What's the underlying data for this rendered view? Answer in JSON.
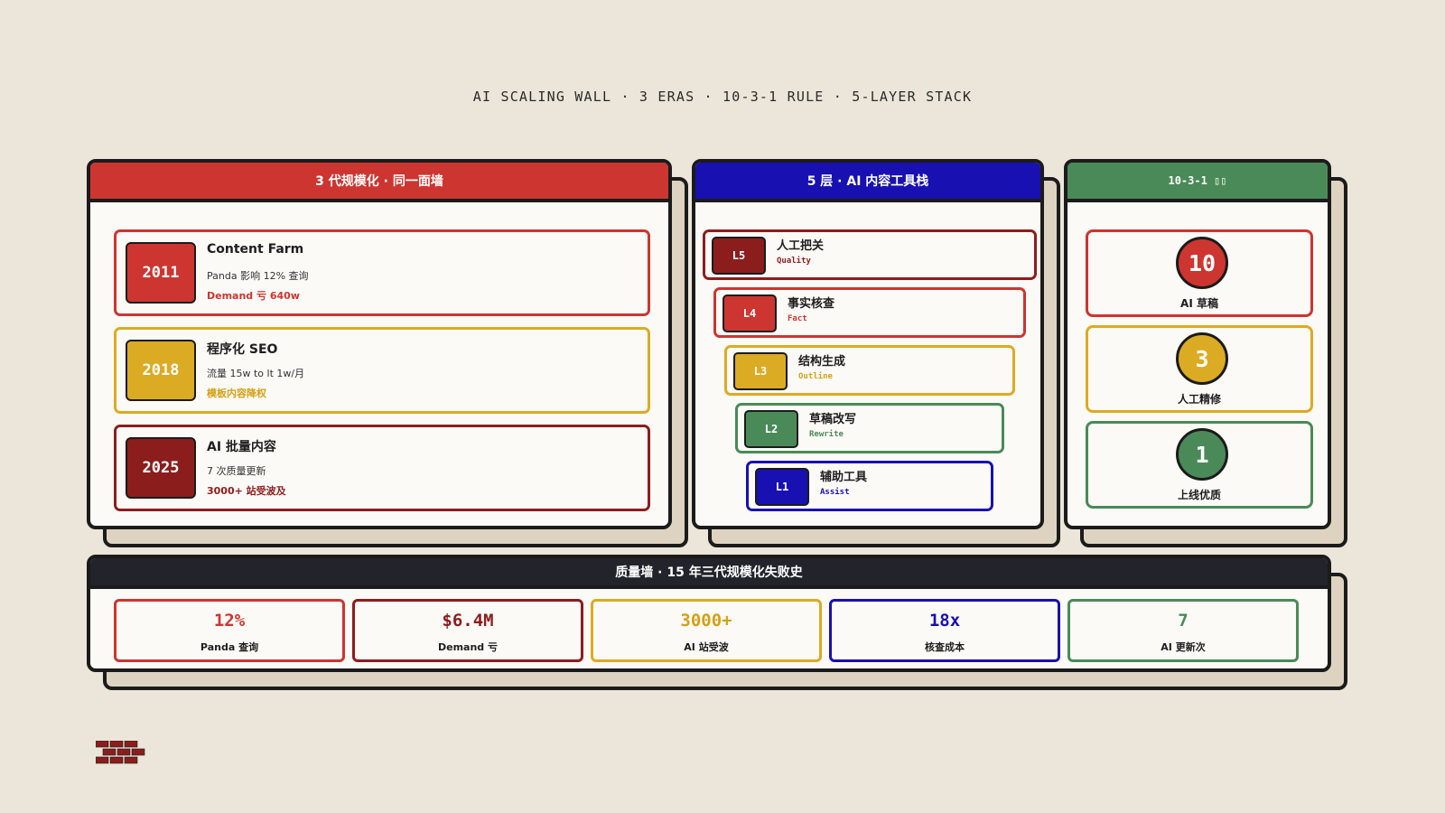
{
  "page_title": "AI SCALING WALL · 3 ERAS · 10-3-1 RULE · 5-LAYER STACK",
  "colors": {
    "red": "#cd3530",
    "dark_red": "#8c1d1d",
    "yellow": "#dcab24",
    "green": "#4a8a58",
    "blue": "#1810b0",
    "dark": "#22232b",
    "background": "#ebe6d9"
  },
  "eras_panel": {
    "title": "3 代规模化 · 同一面墙",
    "items": [
      {
        "year": "2011",
        "title": "Content Farm",
        "desc": "Panda 影响 12% 查询",
        "note": "Demand 亏 640w"
      },
      {
        "year": "2018",
        "title": "程序化 SEO",
        "desc": "流量 15w to lt 1w/月",
        "note": "模板内容降权"
      },
      {
        "year": "2025",
        "title": "AI 批量内容",
        "desc": "7 次质量更新",
        "note": "3000+ 站受波及"
      }
    ]
  },
  "layers_panel": {
    "title": "5 层 · AI 内容工具栈",
    "items": [
      {
        "code": "L5",
        "title": "人工把关",
        "sub": "Quality"
      },
      {
        "code": "L4",
        "title": "事实核查",
        "sub": "Fact"
      },
      {
        "code": "L3",
        "title": "结构生成",
        "sub": "Outline"
      },
      {
        "code": "L2",
        "title": "草稿改写",
        "sub": "Rewrite"
      },
      {
        "code": "L1",
        "title": "辅助工具",
        "sub": "Assist"
      }
    ]
  },
  "rule_panel": {
    "title": "10-3-1 ▯▯",
    "items": [
      {
        "number": "10",
        "label": "AI 草稿"
      },
      {
        "number": "3",
        "label": "人工精修"
      },
      {
        "number": "1",
        "label": "上线优质"
      }
    ]
  },
  "quality_wall": {
    "title": "质量墙 · 15 年三代规模化失败史",
    "stats": [
      {
        "value": "12%",
        "label": "Panda 查询"
      },
      {
        "value": "$6.4M",
        "label": "Demand 亏"
      },
      {
        "value": "3000+",
        "label": "AI 站受波"
      },
      {
        "value": "18x",
        "label": "核查成本"
      },
      {
        "value": "7",
        "label": "AI 更新次"
      }
    ]
  },
  "footer_icon": "brick-wall-icon"
}
